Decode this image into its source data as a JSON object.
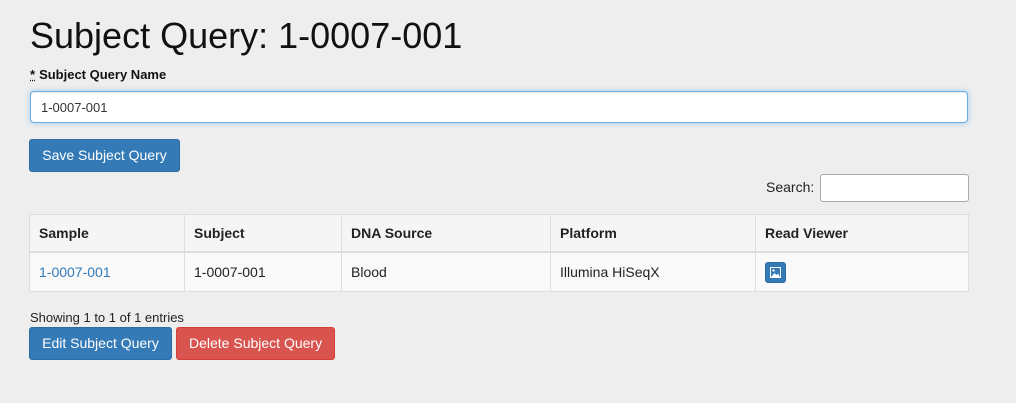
{
  "page": {
    "title": "Subject Query: 1-0007-001"
  },
  "form": {
    "required_marker": "*",
    "name_label": "Subject Query Name",
    "name_value": "1-0007-001",
    "save_label": "Save Subject Query"
  },
  "search": {
    "label": "Search:",
    "value": ""
  },
  "table": {
    "columns": [
      "Sample",
      "Subject",
      "DNA Source",
      "Platform",
      "Read Viewer"
    ],
    "rows": [
      {
        "sample": "1-0007-001",
        "subject": "1-0007-001",
        "dna_source": "Blood",
        "platform": "Illumina HiSeqX",
        "read_viewer_icon": "image-icon"
      }
    ]
  },
  "info": "Showing 1 to 1 of 1 entries",
  "actions": {
    "edit_label": "Edit Subject Query",
    "delete_label": "Delete Subject Query"
  },
  "colors": {
    "primary": "#337ab7",
    "danger": "#d9534f",
    "background": "#eeeeee",
    "link": "#337ab7"
  }
}
